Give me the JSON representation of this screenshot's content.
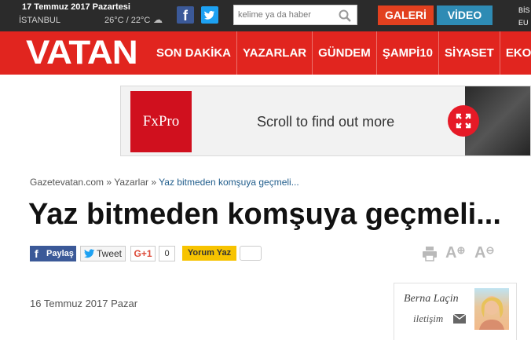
{
  "topbar": {
    "date": "17 Temmuz 2017 Pazartesi",
    "city": "İSTANBUL",
    "temperature": "26°C / 22°C",
    "search_placeholder": "kelime ya da haber",
    "galeri_label": "GALERİ",
    "video_label": "VİDEO",
    "right_cut": [
      "BİS",
      "EU"
    ]
  },
  "nav": {
    "logo": "VATAN",
    "items": [
      "SON DAKİKA",
      "YAZARLAR",
      "GÜNDEM",
      "ŞAMPİ10",
      "SİYASET",
      "EKO"
    ]
  },
  "ad": {
    "brand": "FxPro",
    "text": "Scroll to find out more"
  },
  "breadcrumb": {
    "home": "Gazetevatan.com",
    "sep": "»",
    "section": "Yazarlar",
    "current": "Yaz bitmeden komşuya geçmeli..."
  },
  "article": {
    "title": "Yaz bitmeden komşuya geçmeli...",
    "date": "16 Temmuz 2017 Pazar"
  },
  "share": {
    "facebook_label": "Paylaş",
    "twitter_label": "Tweet",
    "gplus_label": "G+1",
    "gplus_count": "0",
    "comment_label": "Yorum Yaz"
  },
  "author": {
    "name": "Berna Laçin",
    "contact": "iletişim"
  },
  "colors": {
    "brand_red": "#e1251f",
    "topbar": "#2b2b2b",
    "galeri": "#e2401f",
    "video": "#2e8bb4"
  }
}
